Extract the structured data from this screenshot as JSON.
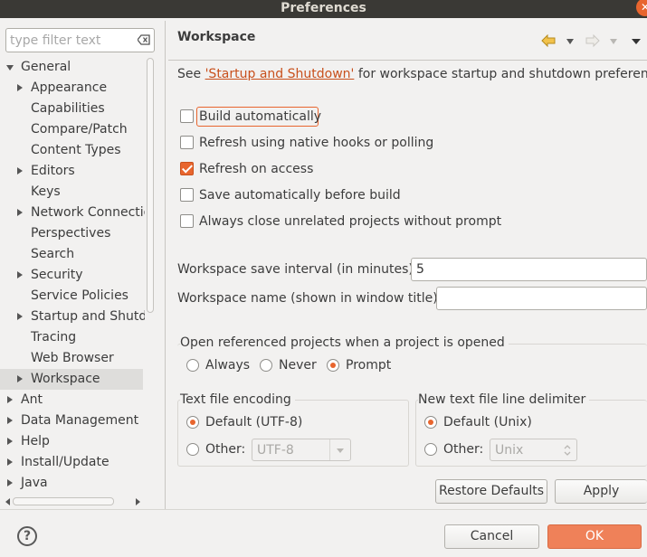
{
  "window": {
    "title": "Preferences"
  },
  "sidebar": {
    "filter_placeholder": "type filter text",
    "tree": [
      {
        "label": "General"
      },
      {
        "label": "Appearance"
      },
      {
        "label": "Capabilities"
      },
      {
        "label": "Compare/Patch"
      },
      {
        "label": "Content Types"
      },
      {
        "label": "Editors"
      },
      {
        "label": "Keys"
      },
      {
        "label": "Network Connections"
      },
      {
        "label": "Perspectives"
      },
      {
        "label": "Search"
      },
      {
        "label": "Security"
      },
      {
        "label": "Service Policies"
      },
      {
        "label": "Startup and Shutdown"
      },
      {
        "label": "Tracing"
      },
      {
        "label": "Web Browser"
      },
      {
        "label": "Workspace"
      },
      {
        "label": "Ant"
      },
      {
        "label": "Data Management"
      },
      {
        "label": "Help"
      },
      {
        "label": "Install/Update"
      },
      {
        "label": "Java"
      }
    ]
  },
  "page": {
    "title": "Workspace",
    "intro_prefix": "See ",
    "intro_link": "'Startup and Shutdown'",
    "intro_suffix": " for workspace startup and shutdown preferences.",
    "checkboxes": [
      {
        "label": "Build automatically",
        "checked": false
      },
      {
        "label": "Refresh using native hooks or polling",
        "checked": false
      },
      {
        "label": "Refresh on access",
        "checked": true
      },
      {
        "label": "Save automatically before build",
        "checked": false
      },
      {
        "label": "Always close unrelated projects without prompt",
        "checked": false
      }
    ],
    "save_interval": {
      "label": "Workspace save interval (in minutes):",
      "value": "5"
    },
    "workspace_name": {
      "label": "Workspace name (shown in window title):",
      "value": ""
    },
    "open_referenced": {
      "label": "Open referenced projects when a project is opened",
      "options": [
        "Always",
        "Never",
        "Prompt"
      ],
      "selected": "Prompt"
    },
    "encoding": {
      "label": "Text file encoding",
      "default_label": "Default (UTF-8)",
      "other_label": "Other:",
      "other_value": "UTF-8",
      "selected": "default"
    },
    "line_delimiter": {
      "label": "New text file line delimiter",
      "default_label": "Default (Unix)",
      "other_label": "Other:",
      "other_value": "Unix",
      "selected": "default"
    },
    "restore_defaults": "Restore Defaults",
    "apply": "Apply"
  },
  "footer": {
    "help_glyph": "?",
    "cancel": "Cancel",
    "ok": "OK"
  },
  "colors": {
    "accent": "#e8652e",
    "link": "#c8501c",
    "ok_button": "#ef8159"
  },
  "icons": [
    "close-icon",
    "clear-filter-icon",
    "back-arrow-icon",
    "forward-arrow-icon",
    "view-menu-icon",
    "help-icon",
    "expand-triangle-icon",
    "collapse-triangle-icon"
  ]
}
